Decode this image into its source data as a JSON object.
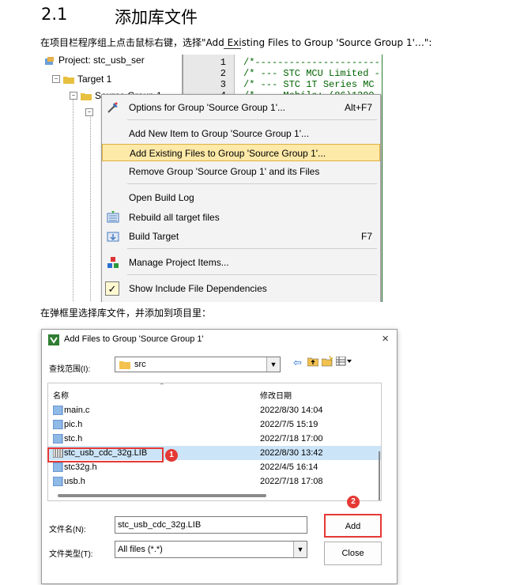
{
  "doc": {
    "section_number": "2.1",
    "section_title": "添加库文件",
    "instruction1": "在项目栏程序组上点击鼠标右键，选择\"Add Existing Files to Group 'Source Group 1'…\":",
    "instruction2": "在弹框里选择库文件，并添加到项目里："
  },
  "tree": {
    "project": "Project: stc_usb_ser",
    "target": "Target 1",
    "group": "Source Group 1"
  },
  "editor": {
    "line_numbers": [
      "1",
      "2",
      "3",
      "4"
    ],
    "lines": [
      "/*-----------------------",
      "/* --- STC MCU Limited ---",
      "/* --- STC 1T Series MC",
      "/* --- Mobile: (86)1390"
    ]
  },
  "context_menu": {
    "items": [
      {
        "label": "Options for Group 'Source Group 1'...",
        "shortcut": "Alt+F7",
        "icon": "options-icon"
      },
      {
        "label": "Add New  Item to Group 'Source Group 1'...",
        "shortcut": ""
      },
      {
        "label": "Add Existing Files to Group 'Source Group 1'...",
        "shortcut": ""
      },
      {
        "label": "Remove Group 'Source Group 1' and its Files",
        "shortcut": ""
      },
      {
        "label": "Open Build Log",
        "shortcut": ""
      },
      {
        "label": "Rebuild all target files",
        "shortcut": "",
        "icon": "rebuild-icon"
      },
      {
        "label": "Build Target",
        "shortcut": "F7",
        "icon": "build-icon"
      },
      {
        "label": "Manage Project Items...",
        "shortcut": "",
        "icon": "manage-icon"
      },
      {
        "label": "Show Include File Dependencies",
        "shortcut": "",
        "icon": "checkmark-icon"
      }
    ]
  },
  "dialog": {
    "title": "Add Files to Group 'Source Group 1'",
    "look_in_label": "查找范围(I):",
    "look_in_value": "src",
    "col_name": "名称",
    "col_date": "修改日期",
    "files": [
      {
        "name": "main.c",
        "date": "2022/8/30 14:04"
      },
      {
        "name": "pic.h",
        "date": "2022/7/5 15:19"
      },
      {
        "name": "stc.h",
        "date": "2022/7/18 17:00"
      },
      {
        "name": "stc_usb_cdc_32g.LIB",
        "date": "2022/8/30 13:42"
      },
      {
        "name": "stc32g.h",
        "date": "2022/4/5 16:14"
      },
      {
        "name": "usb.h",
        "date": "2022/7/18 17:08"
      }
    ],
    "filename_label": "文件名(N):",
    "filename_value": "stc_usb_cdc_32g.LIB",
    "filetype_label": "文件类型(T):",
    "filetype_value": "All files (*.*)",
    "add_button": "Add",
    "close_button": "Close",
    "close_icon": "×",
    "badge1": "1",
    "badge2": "2"
  }
}
